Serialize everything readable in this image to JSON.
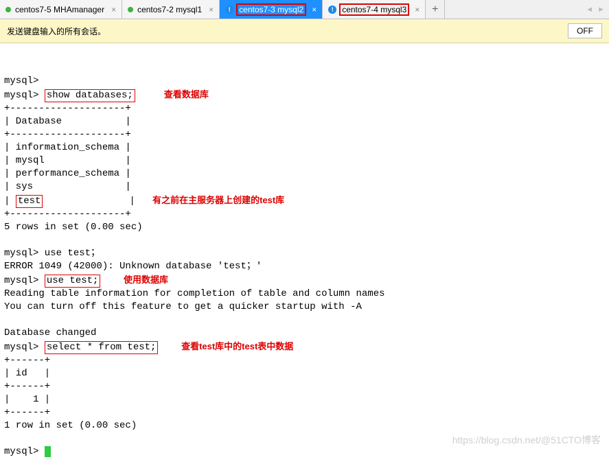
{
  "tabs": [
    {
      "label": "centos7-5 MHAmanager",
      "icon": "green"
    },
    {
      "label": "centos7-2 mysql1",
      "icon": "green"
    },
    {
      "label": "centos7-3 mysql2",
      "icon": "info",
      "active": true,
      "redbox": true
    },
    {
      "label": "centos7-4 mysql3",
      "icon": "info",
      "redbox": true
    }
  ],
  "subbar_text": "发送键盘输入的所有会话。",
  "off_label": "OFF",
  "comments": {
    "c1": "查看数据库",
    "c2": "有之前在主服务器上创建的test库",
    "c3": "使用数据库",
    "c4": "查看test库中的test表中数据"
  },
  "boxed": {
    "b1": "show databases;",
    "b2": "test",
    "b3": "use test;",
    "b4": "select * from test;"
  },
  "lines": {
    "l0": "",
    "p1": "mysql>",
    "p2": "mysql> ",
    "sep": "+--------------------+",
    "dbh": "| Database           |",
    "d1": "| information_schema |",
    "d2": "| mysql              |",
    "d3": "| performance_schema |",
    "d4": "| sys                |",
    "d5pre": "| ",
    "d5post": "               |",
    "r1": "5 rows in set (0.00 sec)",
    "u1": "mysql> use test；",
    "u2": "ERROR 1049 (42000): Unknown database 'test；'",
    "u3pre": "mysql> ",
    "r2": "Reading table information for completion of table and column names",
    "r3": "You can turn off this feature to get a quicker startup with -A",
    "dc": "Database changed",
    "tsep": "+------+",
    "th": "| id   |",
    "tr1": "|    1 |",
    "fr": "1 row in set (0.00 sec)",
    "pend": "mysql> "
  },
  "watermark": "https://blog.csdn.net/@51CTO博客"
}
